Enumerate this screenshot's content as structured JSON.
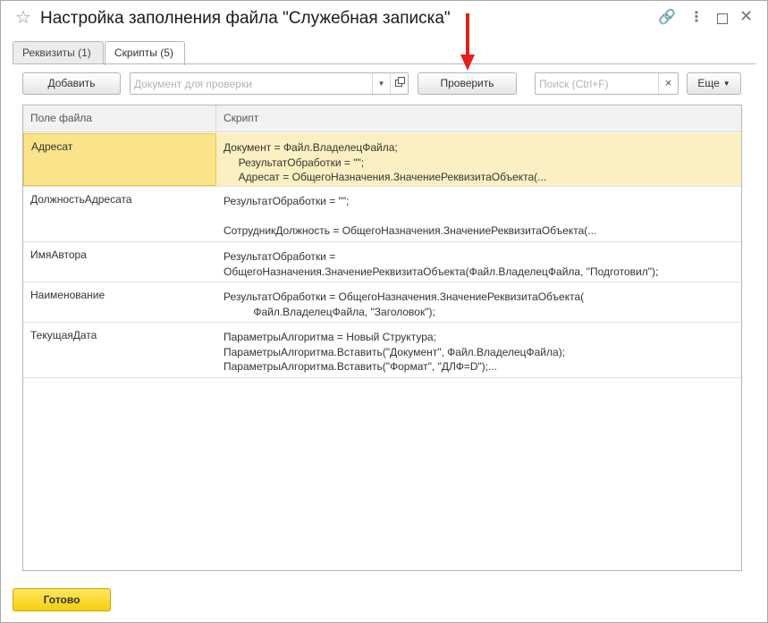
{
  "window": {
    "title": "Настройка заполнения файла \"Служебная записка\"",
    "icons": {
      "star": "star-icon",
      "link": "link-icon",
      "more": "more-vertical-icon",
      "maximize": "maximize-icon",
      "close": "close-icon"
    }
  },
  "tabs": [
    {
      "label": "Реквизиты (1)",
      "active": false
    },
    {
      "label": "Скрипты (5)",
      "active": true
    }
  ],
  "toolbar": {
    "add_label": "Добавить",
    "document_placeholder": "Документ для проверки",
    "check_label": "Проверить",
    "search_placeholder": "Поиск (Ctrl+F)",
    "clear_glyph": "×",
    "more_label": "Еще"
  },
  "table": {
    "columns": [
      "Поле файла",
      "Скрипт"
    ],
    "rows": [
      {
        "field": "Адресат",
        "script": "Документ = Файл.ВладелецФайла;\n     РезультатОбработки = \"\";\n     Адресат = ОбщегоНазначения.ЗначениеРеквизитаОбъекта(...",
        "selected": true
      },
      {
        "field": "ДолжностьАдресата",
        "script": "РезультатОбработки = \"\";\n\nСотрудникДолжность = ОбщегоНазначения.ЗначениеРеквизитаОбъекта(...",
        "selected": false
      },
      {
        "field": "ИмяАвтора",
        "script": "РезультатОбработки =\nОбщегоНазначения.ЗначениеРеквизитаОбъекта(Файл.ВладелецФайла, \"Подготовил\");",
        "selected": false
      },
      {
        "field": "Наименование",
        "script": "РезультатОбработки = ОбщегоНазначения.ЗначениеРеквизитаОбъекта(\n          Файл.ВладелецФайла, \"Заголовок\");",
        "selected": false
      },
      {
        "field": "ТекущаяДата",
        "script": "ПараметрыАлгоритма = Новый Структура;\nПараметрыАлгоритма.Вставить(\"Документ\", Файл.ВладелецФайла);\nПараметрыАлгоритма.Вставить(\"Формат\", \"ДЛФ=D\");...",
        "selected": false
      }
    ]
  },
  "footer": {
    "done_label": "Готово"
  },
  "colors": {
    "accent_yellow": "#f5cf0f",
    "selected_row": "#fbf0c1",
    "arrow_red": "#e0201b"
  }
}
